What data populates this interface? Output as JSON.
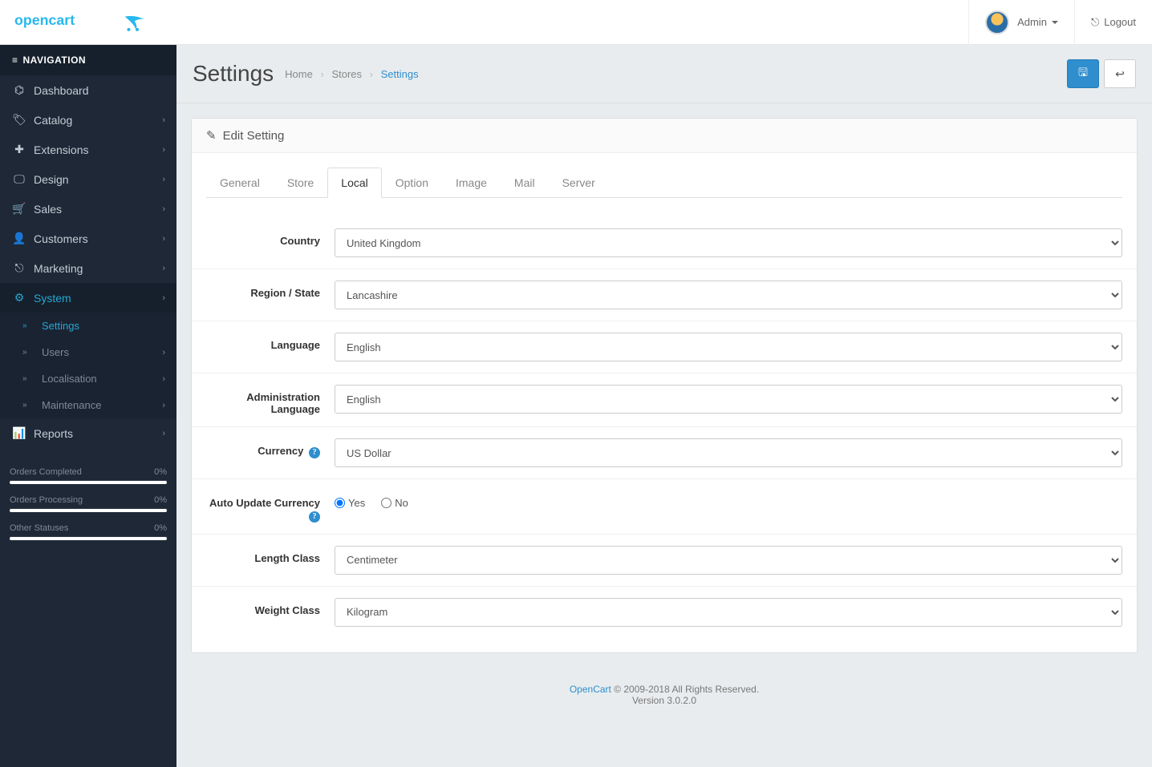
{
  "header": {
    "user_label": "Admin",
    "logout_label": "Logout"
  },
  "sidebar": {
    "title": "NAVIGATION",
    "items": [
      {
        "label": "Dashboard",
        "icon": "dashboard",
        "children": false,
        "active": false
      },
      {
        "label": "Catalog",
        "icon": "tag",
        "children": true,
        "active": false
      },
      {
        "label": "Extensions",
        "icon": "puzzle",
        "children": true,
        "active": false
      },
      {
        "label": "Design",
        "icon": "desktop",
        "children": true,
        "active": false
      },
      {
        "label": "Sales",
        "icon": "cart",
        "children": true,
        "active": false
      },
      {
        "label": "Customers",
        "icon": "user",
        "children": true,
        "active": false
      },
      {
        "label": "Marketing",
        "icon": "share",
        "children": true,
        "active": false
      },
      {
        "label": "System",
        "icon": "gear",
        "children": true,
        "active": true
      },
      {
        "label": "Reports",
        "icon": "chart",
        "children": true,
        "active": false
      }
    ],
    "system_sub": [
      {
        "label": "Settings",
        "active": true,
        "children": false
      },
      {
        "label": "Users",
        "active": false,
        "children": true
      },
      {
        "label": "Localisation",
        "active": false,
        "children": true
      },
      {
        "label": "Maintenance",
        "active": false,
        "children": true
      }
    ],
    "stats": [
      {
        "label": "Orders Completed",
        "value": "0%"
      },
      {
        "label": "Orders Processing",
        "value": "0%"
      },
      {
        "label": "Other Statuses",
        "value": "0%"
      }
    ]
  },
  "page": {
    "title": "Settings",
    "breadcrumb": [
      "Home",
      "Stores",
      "Settings"
    ],
    "panel_title": "Edit Setting"
  },
  "tabs": [
    "General",
    "Store",
    "Local",
    "Option",
    "Image",
    "Mail",
    "Server"
  ],
  "active_tab": "Local",
  "form": {
    "country": {
      "label": "Country",
      "value": "United Kingdom"
    },
    "region": {
      "label": "Region / State",
      "value": "Lancashire"
    },
    "language": {
      "label": "Language",
      "value": "English"
    },
    "admin_language": {
      "label": "Administration Language",
      "value": "English"
    },
    "currency": {
      "label": "Currency",
      "value": "US Dollar",
      "help": true
    },
    "auto_update_currency": {
      "label": "Auto Update Currency",
      "help": true,
      "yes": "Yes",
      "no": "No",
      "value": "Yes"
    },
    "length_class": {
      "label": "Length Class",
      "value": "Centimeter"
    },
    "weight_class": {
      "label": "Weight Class",
      "value": "Kilogram"
    }
  },
  "footer": {
    "link_text": "OpenCart",
    "copyright": " © 2009-2018 All Rights Reserved.",
    "version": "Version 3.0.2.0"
  }
}
